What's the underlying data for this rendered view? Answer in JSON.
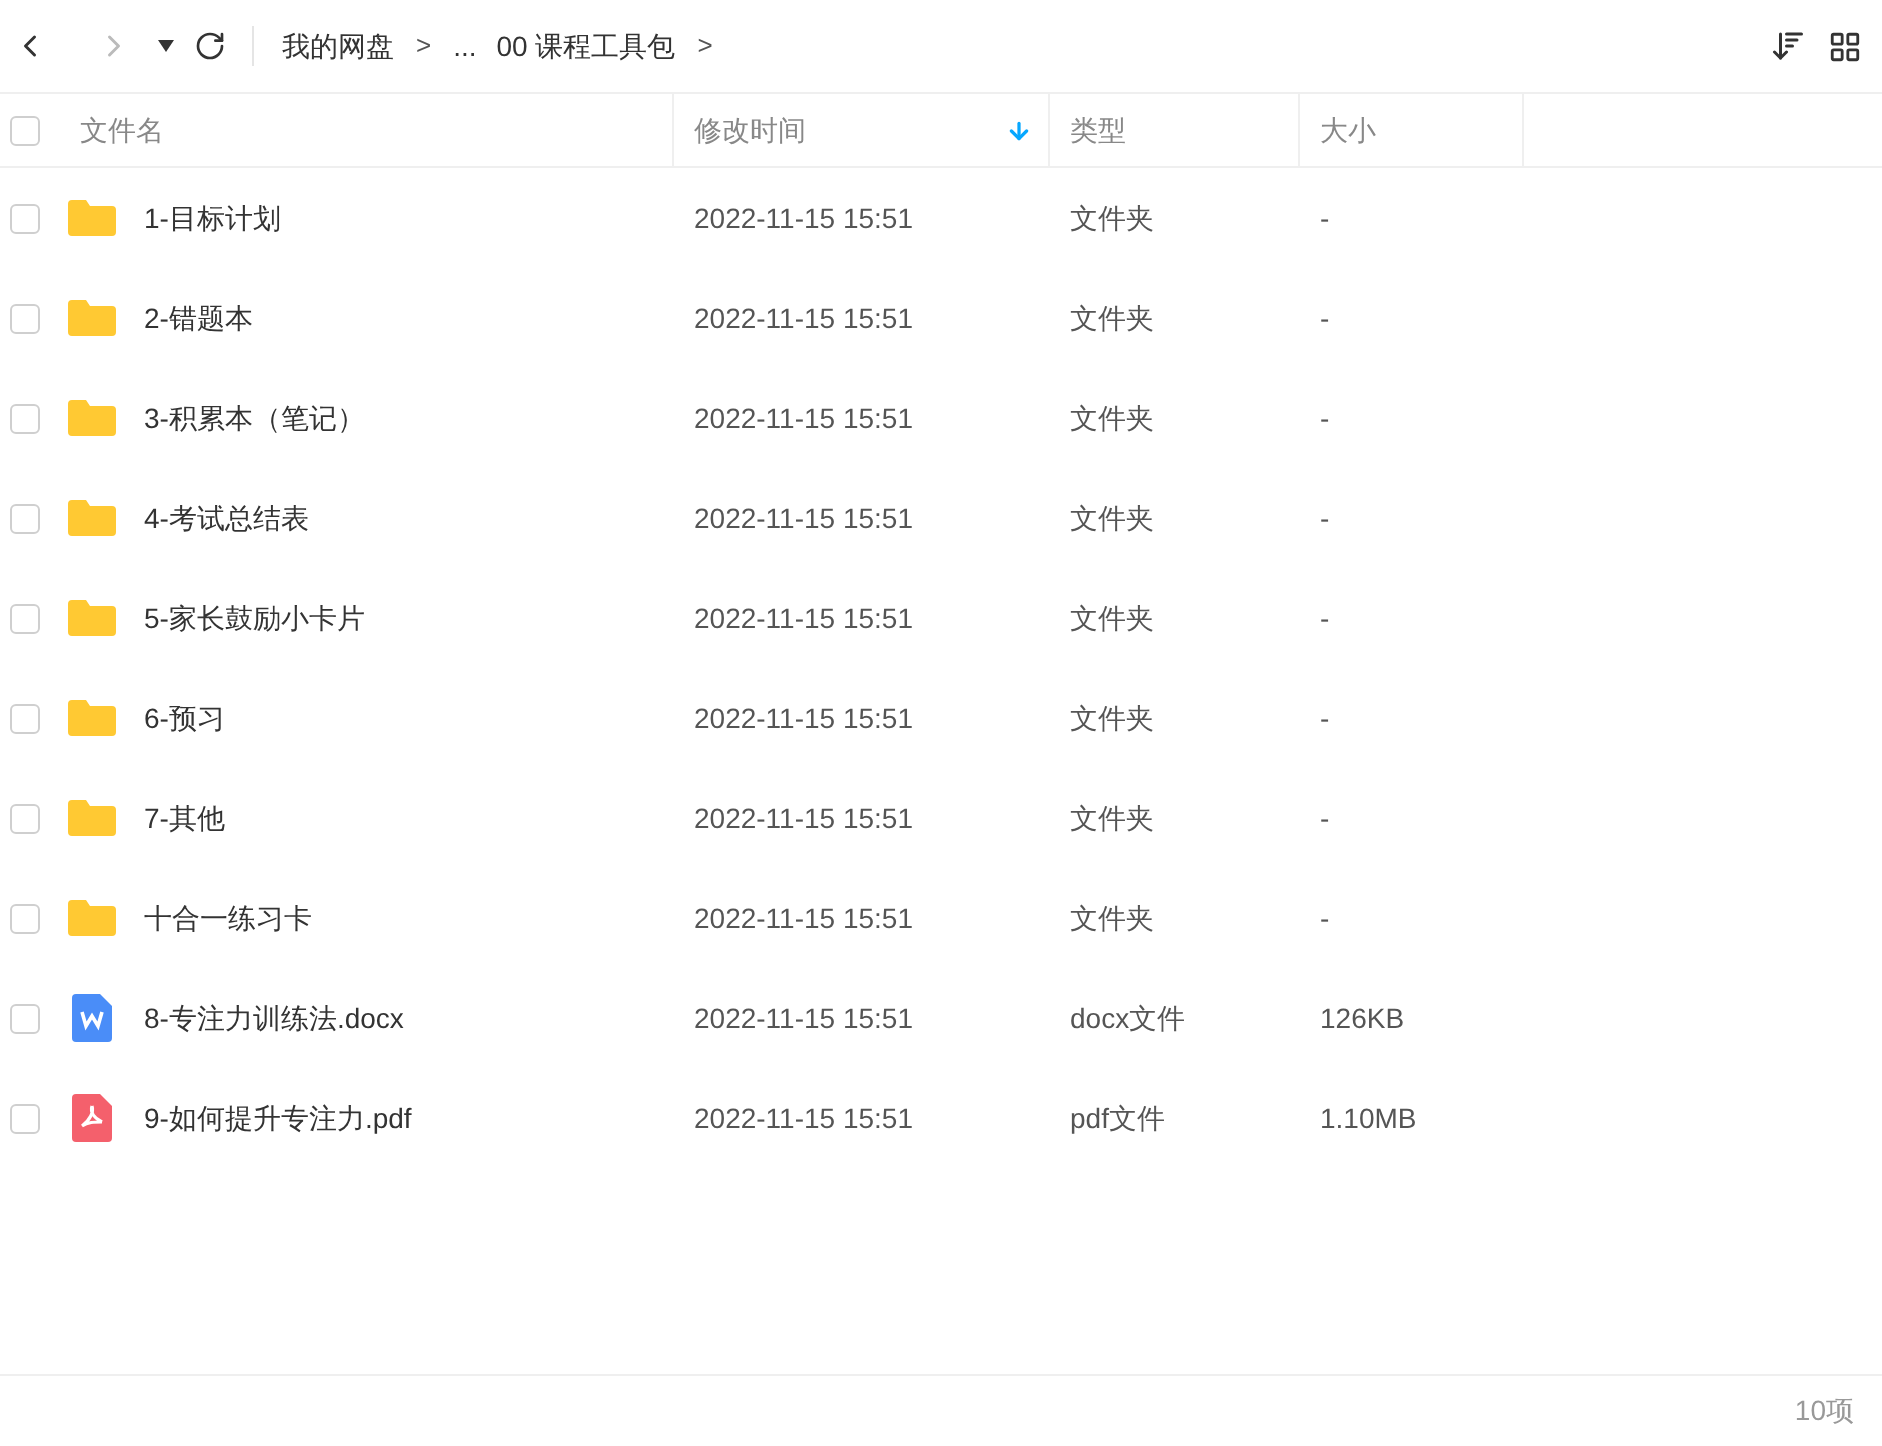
{
  "breadcrumb": [
    {
      "kind": "link",
      "text": "我的网盘"
    },
    {
      "kind": "separator",
      "text": ">"
    },
    {
      "kind": "link",
      "text": "..."
    },
    {
      "kind": "link",
      "text": "00 课程工具包"
    },
    {
      "kind": "separator",
      "text": ">"
    }
  ],
  "columns": [
    {
      "label": "文件名",
      "sorted": false
    },
    {
      "label": "修改时间",
      "sorted": true
    },
    {
      "label": "类型",
      "sorted": false
    },
    {
      "label": "大小",
      "sorted": false
    }
  ],
  "select_all": {
    "checked": false
  },
  "rows": [
    {
      "kind": "folder",
      "name": "1-目标计划",
      "time": "2022-11-15 15:51",
      "type": "文件夹",
      "size": "-",
      "checked": false
    },
    {
      "kind": "folder",
      "name": "2-错题本",
      "time": "2022-11-15 15:51",
      "type": "文件夹",
      "size": "-",
      "checked": false
    },
    {
      "kind": "folder",
      "name": "3-积累本（笔记）",
      "time": "2022-11-15 15:51",
      "type": "文件夹",
      "size": "-",
      "checked": false
    },
    {
      "kind": "folder",
      "name": "4-考试总结表",
      "time": "2022-11-15 15:51",
      "type": "文件夹",
      "size": "-",
      "checked": false
    },
    {
      "kind": "folder",
      "name": "5-家长鼓励小卡片",
      "time": "2022-11-15 15:51",
      "type": "文件夹",
      "size": "-",
      "checked": false
    },
    {
      "kind": "folder",
      "name": "6-预习",
      "time": "2022-11-15 15:51",
      "type": "文件夹",
      "size": "-",
      "checked": false
    },
    {
      "kind": "folder",
      "name": "7-其他",
      "time": "2022-11-15 15:51",
      "type": "文件夹",
      "size": "-",
      "checked": false
    },
    {
      "kind": "folder",
      "name": "十合一练习卡",
      "time": "2022-11-15 15:51",
      "type": "文件夹",
      "size": "-",
      "checked": false
    },
    {
      "kind": "docx",
      "name": "8-专注力训练法.docx",
      "time": "2022-11-15 15:51",
      "type": "docx文件",
      "size": "126KB",
      "checked": false
    },
    {
      "kind": "pdf",
      "name": "9-如何提升专注力.pdf",
      "time": "2022-11-15 15:51",
      "type": "pdf文件",
      "size": "1.10MB",
      "checked": false
    }
  ],
  "item_count": "10项"
}
